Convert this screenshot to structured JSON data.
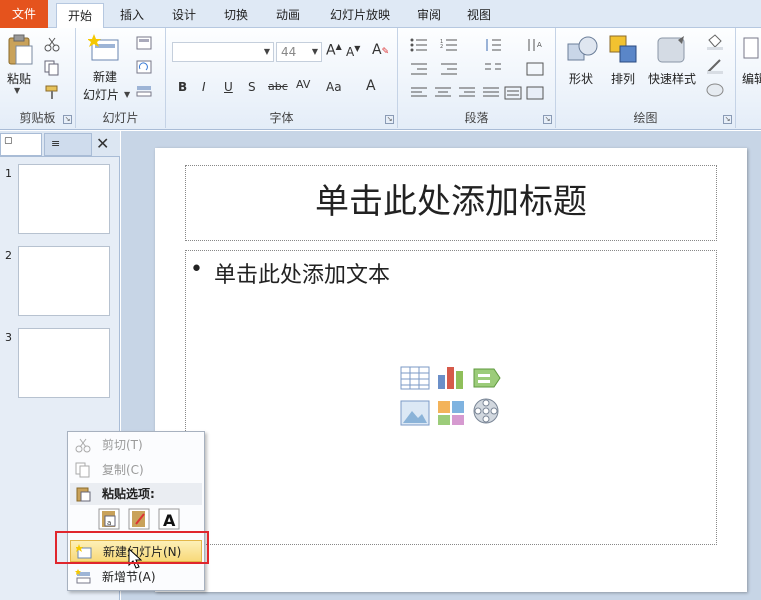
{
  "tabs": [
    "文件",
    "开始",
    "插入",
    "设计",
    "切换",
    "动画",
    "幻灯片放映",
    "审阅",
    "视图"
  ],
  "ribbon": {
    "clipboard": {
      "paste": "粘贴",
      "group": "剪贴板"
    },
    "slides": {
      "new_slide_1": "新建",
      "new_slide_2": "幻灯片",
      "group": "幻灯片"
    },
    "font": {
      "size": "44",
      "group": "字体"
    },
    "paragraph": {
      "group": "段落"
    },
    "drawing": {
      "shapes": "形状",
      "arrange": "排列",
      "quick_styles": "快速样式",
      "group": "绘图"
    },
    "edit": {
      "label": "编辑"
    }
  },
  "panel": {
    "slides": [
      "1",
      "2",
      "3"
    ]
  },
  "slide": {
    "title": "单击此处添加标题",
    "body": "单击此处添加文本",
    "bullet": "•"
  },
  "menu": {
    "cut": "剪切(T)",
    "copy": "复制(C)",
    "paste_options": "粘贴选项:",
    "new_slide": "新建幻灯片(N)",
    "new_section": "新增节(A)"
  },
  "colors": {
    "file_tab": "#e5531d",
    "highlight": "#f8d97a",
    "callout": "#e0262d"
  }
}
